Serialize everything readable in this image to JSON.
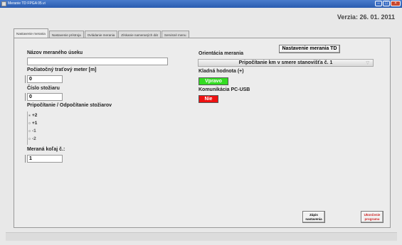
{
  "window": {
    "title": "Meranie TD FPGA 05.vi"
  },
  "version": "Verzia: 26. 01. 2011",
  "tabs": [
    {
      "label": "Nastavenie merania"
    },
    {
      "label": "Nastavenie prístroja"
    },
    {
      "label": "Ovládanie merania"
    },
    {
      "label": "Získanie nameraných dát"
    },
    {
      "label": "Servisné menu"
    }
  ],
  "left": {
    "section_name_label": "Názov meraného úseku",
    "section_name_value": "",
    "start_meter_label": "Počiatočný traťový meter [m]",
    "start_meter_value": "0",
    "pole_number_label": "Číslo stožiaru",
    "pole_number_value": "0",
    "pole_count_label": "Pripočítanie / Odpočítanie stožiarov",
    "pole_count_options": [
      "+2",
      "+1",
      "-1",
      "-2"
    ],
    "track_label": "Meraná koľaj č.:",
    "track_value": "1"
  },
  "right": {
    "settings_button": "Nastavenie merania TD",
    "orientation_label": "Orientácia merania",
    "orientation_value": "Pripočítanie km v smere stanovišťa č. 1",
    "positive_label": "Kladná hodnota (+)",
    "positive_value": "Vpravo",
    "comm_label": "Komunikácia PC-USB",
    "comm_value": "Nie"
  },
  "buttons": {
    "save_line1": "Zápis",
    "save_line2": "nastavenia",
    "quit_line1": "Ukončenie",
    "quit_line2": "programu"
  },
  "colors": {
    "positive_bg": "#33dd22",
    "comm_bg": "#ee1111",
    "quit_text": "#cc2222"
  }
}
